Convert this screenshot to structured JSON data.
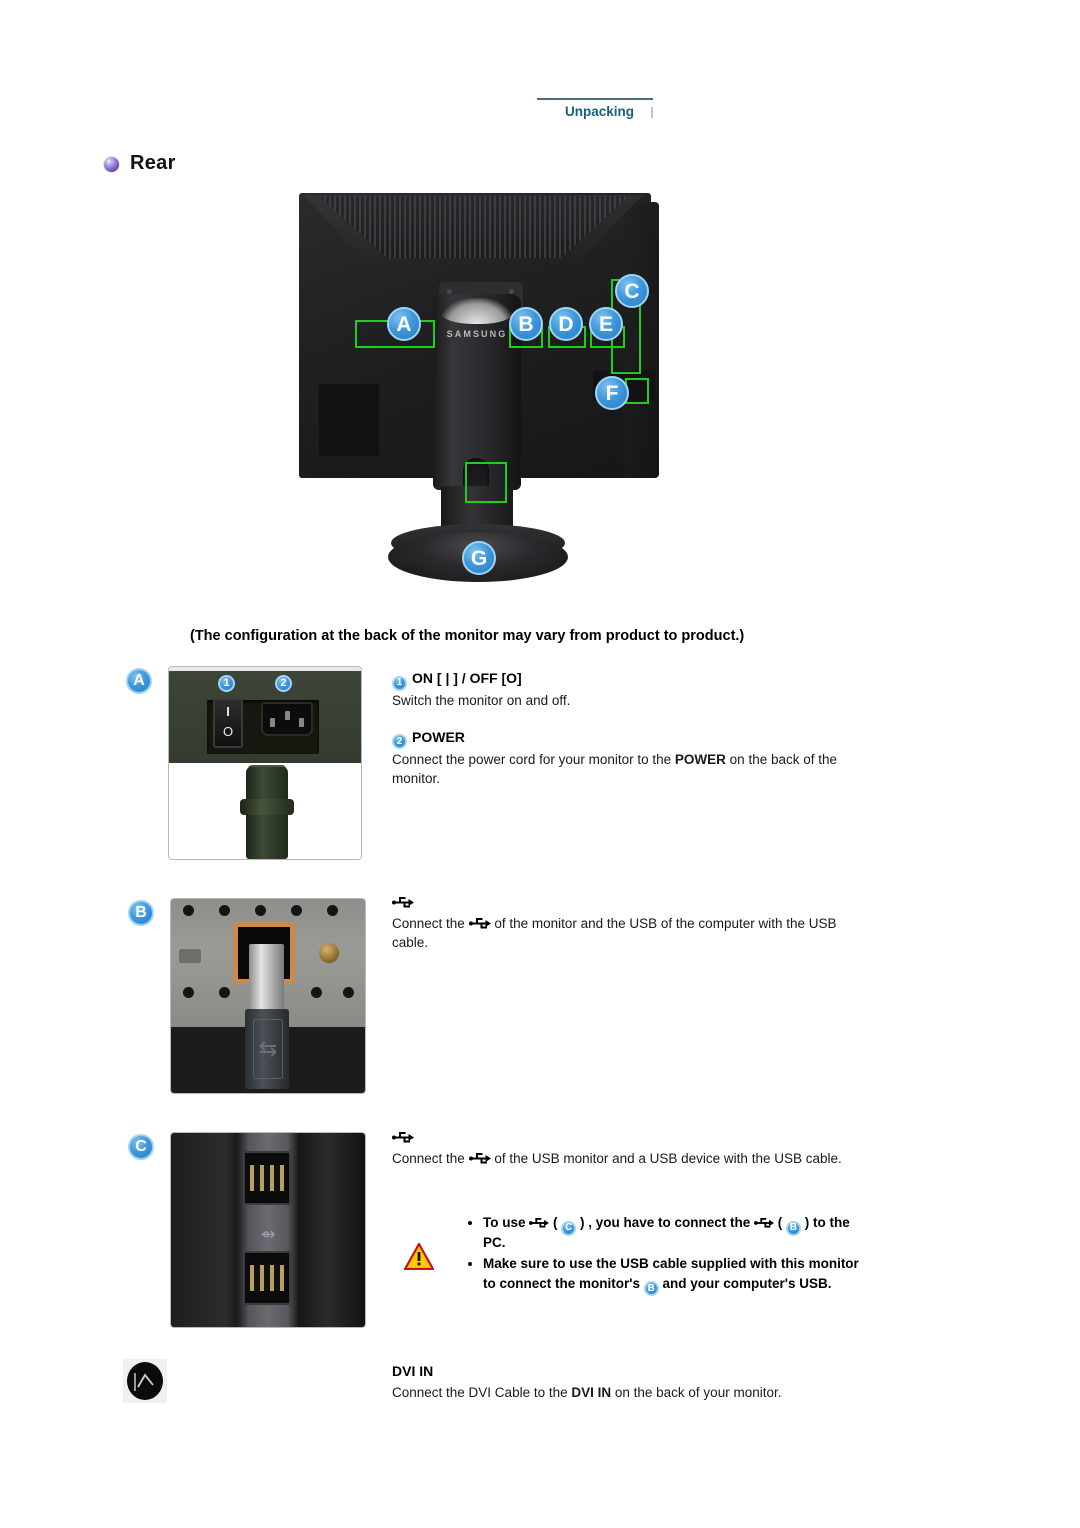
{
  "header": {
    "breadcrumb": "Unpacking"
  },
  "section": {
    "title": "Rear",
    "bullet_icon": "purple-sphere-bullet"
  },
  "figure": {
    "brand_text": "SAMSUNG",
    "callouts": [
      {
        "letter": "A"
      },
      {
        "letter": "B"
      },
      {
        "letter": "C"
      },
      {
        "letter": "D"
      },
      {
        "letter": "E"
      },
      {
        "letter": "F"
      },
      {
        "letter": "G"
      }
    ],
    "caption": "(The configuration at the back of the monitor may vary from product to product.)"
  },
  "colors": {
    "callout_blue": "#3d96da",
    "callout_ring": "#9fd4f2",
    "callout_box_green": "#21cc21",
    "breadcrumb_blue": "#17607f",
    "bullet_purple": "#5b3fa8",
    "warning_yellow": "#ffcc00",
    "warning_red": "#cc1111"
  },
  "rows": {
    "a": {
      "letter": "A",
      "photo_badges": [
        "1",
        "2"
      ],
      "switch_on_mark": "I",
      "switch_off_mark": "O",
      "items": [
        {
          "number": "1",
          "title": "ON [ | ] / OFF [O]",
          "body": "Switch the monitor on and off."
        },
        {
          "number": "2",
          "title": "POWER",
          "body_prefix": "Connect the power cord for your monitor to the ",
          "body_bold": "POWER",
          "body_suffix": " on the back of the monitor."
        }
      ]
    },
    "b": {
      "letter": "B",
      "icon": "usb-icon",
      "body_prefix": "Connect the ",
      "body_mid": " of the monitor and the USB of the computer with the USB cable."
    },
    "c": {
      "letter": "C",
      "icon": "usb-icon",
      "body_prefix": "Connect the ",
      "body_mid": " of the USB monitor and a USB device with the USB cable."
    },
    "warning": {
      "icon": "warning-triangle-icon",
      "bullets": [
        {
          "parts": [
            {
              "t": "text",
              "v": "To use "
            },
            {
              "t": "usb"
            },
            {
              "t": "text",
              "v": " ( "
            },
            {
              "t": "badge",
              "v": "C"
            },
            {
              "t": "text",
              "v": " ) , you have to connect the "
            },
            {
              "t": "usb"
            },
            {
              "t": "text",
              "v": " ( "
            },
            {
              "t": "badge",
              "v": "B"
            },
            {
              "t": "text",
              "v": " ) to the PC."
            }
          ]
        },
        {
          "parts": [
            {
              "t": "text",
              "v": "Make sure to use the USB cable supplied with this monitor to connect the monitor's "
            },
            {
              "t": "badge",
              "v": "B"
            },
            {
              "t": "text",
              "v": " and your computer's USB."
            }
          ]
        }
      ]
    },
    "dvi": {
      "icon": "dvi-connector-thumb-icon",
      "title": "DVI IN",
      "body_prefix": "Connect the DVI Cable to the ",
      "body_bold": "DVI IN",
      "body_suffix": " on the back of your monitor."
    }
  }
}
